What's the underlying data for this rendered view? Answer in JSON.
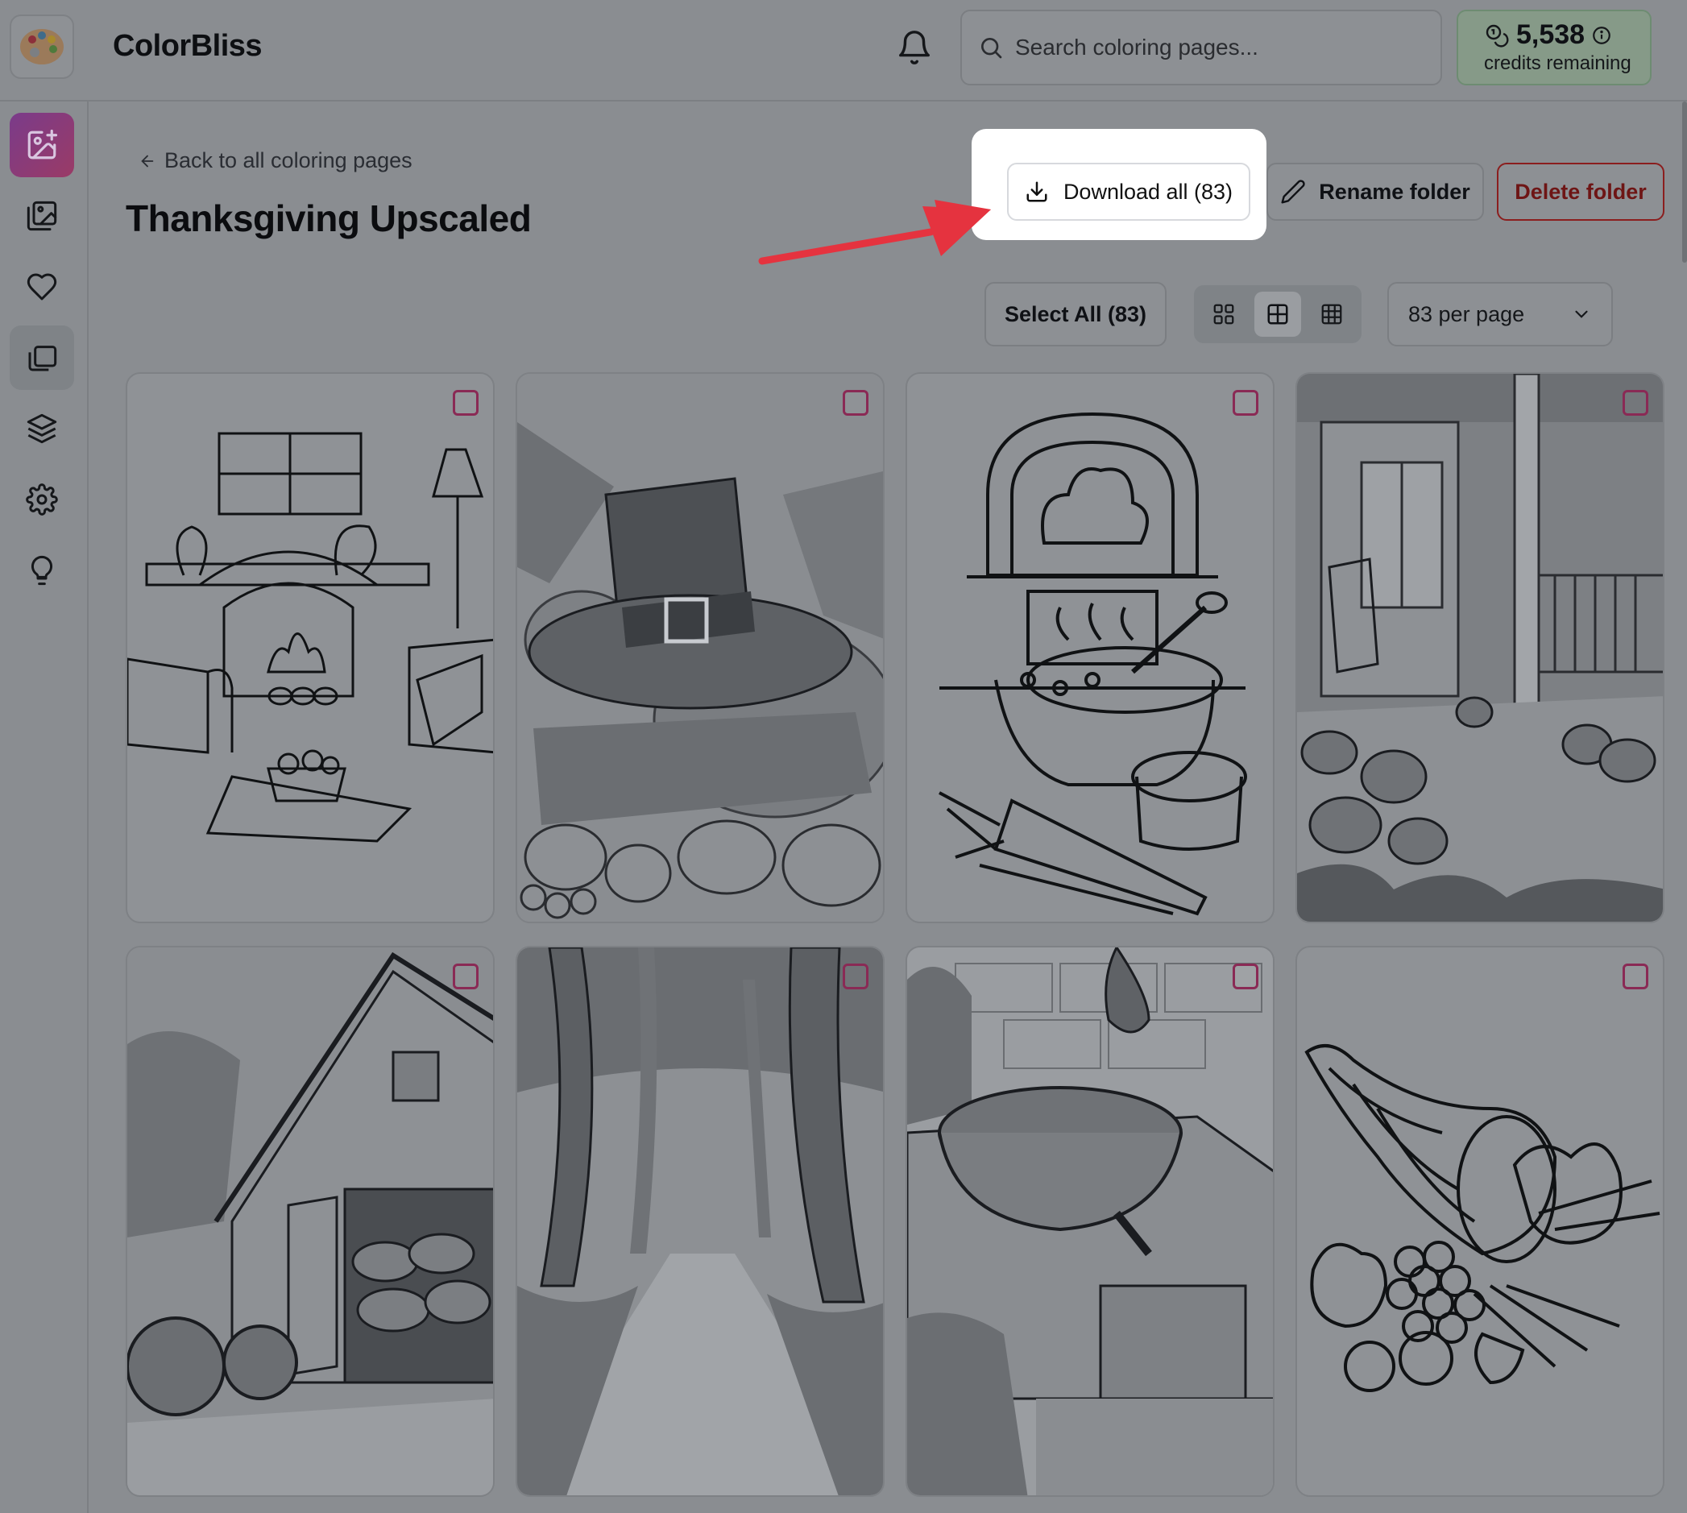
{
  "app": {
    "brand": "ColorBliss",
    "search_placeholder": "Search coloring pages...",
    "credits_value": "5,538",
    "credits_label": "credits remaining"
  },
  "sidebar": {
    "items": [
      {
        "name": "create-image",
        "icon": "image-plus-icon"
      },
      {
        "name": "gallery",
        "icon": "gallery-icon"
      },
      {
        "name": "favorites",
        "icon": "heart-icon"
      },
      {
        "name": "folders",
        "icon": "folders-icon"
      },
      {
        "name": "layers",
        "icon": "layers-icon"
      },
      {
        "name": "settings",
        "icon": "gear-icon"
      },
      {
        "name": "ideas",
        "icon": "lightbulb-icon"
      }
    ]
  },
  "folder": {
    "back_label": "Back to all coloring pages",
    "title": "Thanksgiving Upscaled",
    "download_label": "Download all (83)",
    "rename_label": "Rename folder",
    "delete_label": "Delete folder",
    "select_all_label": "Select All (83)",
    "per_page_label": "83 per page",
    "view_modes": [
      "large-grid",
      "medium-grid",
      "small-grid"
    ],
    "active_view": "medium-grid"
  },
  "cards": [
    {
      "subject": "fireplace living room"
    },
    {
      "subject": "pilgrim hat with pumpkins and wheat"
    },
    {
      "subject": "soup pot with carrots and pie"
    },
    {
      "subject": "porch with rocking chair and pumpkins"
    },
    {
      "subject": "barn with tractor and hay bales"
    },
    {
      "subject": "forest path with autumn leaves"
    },
    {
      "subject": "stew pot on stove"
    },
    {
      "subject": "cornucopia with fruit"
    }
  ],
  "colors": {
    "accent_gradient": [
      "#7a3b8a",
      "#9a3b66"
    ],
    "delete_text": "#6e1515",
    "arrow": "#e5333f",
    "checkbox": "#8a2a55"
  }
}
